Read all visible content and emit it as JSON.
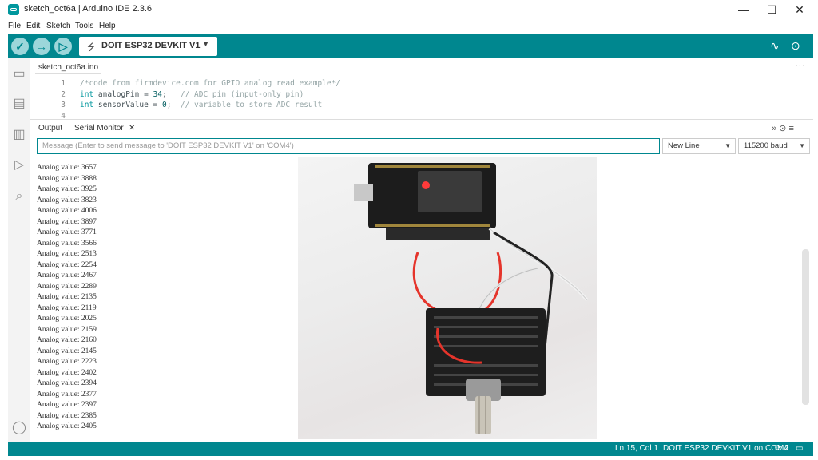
{
  "window": {
    "title": "sketch_oct6a | Arduino IDE 2.3.6",
    "minimize": "—",
    "maximize": "☐",
    "close": "✕"
  },
  "menu": [
    "File",
    "Edit",
    "Sketch",
    "Tools",
    "Help"
  ],
  "toolbar": {
    "verify_icon": "✓",
    "upload_icon": "→",
    "debug_icon": "▷",
    "board": "DOIT ESP32 DEVKIT V1",
    "board_caret": "▼",
    "plotter_icon": "∿",
    "monitor_icon": "⊙"
  },
  "sidebar_icons": [
    "folder-icon",
    "board-icon",
    "library-icon",
    "debug-icon",
    "search-icon",
    "account-icon"
  ],
  "editor": {
    "tab": "sketch_oct6a.ino",
    "more": "···",
    "lines": [
      {
        "num": "1",
        "parts": [
          {
            "t": "/*code from firmdevice.com for GPIO analog read example*/",
            "c": "cm"
          }
        ]
      },
      {
        "num": "2",
        "parts": [
          {
            "t": "int",
            "c": "kw"
          },
          {
            "t": " analogPin = ",
            "c": "tx"
          },
          {
            "t": "34",
            "c": "num"
          },
          {
            "t": ";   ",
            "c": "tx"
          },
          {
            "t": "// ADC pin (input-only pin)",
            "c": "cm"
          }
        ]
      },
      {
        "num": "3",
        "parts": [
          {
            "t": "int",
            "c": "kw"
          },
          {
            "t": " sensorValue = ",
            "c": "tx"
          },
          {
            "t": "0",
            "c": "num"
          },
          {
            "t": ";  ",
            "c": "tx"
          },
          {
            "t": "// variable to store ADC result",
            "c": "cm"
          }
        ]
      },
      {
        "num": "4",
        "parts": []
      }
    ]
  },
  "panel": {
    "tab_output": "Output",
    "tab_serial": "Serial Monitor",
    "tab_close": "✕",
    "right_icons": "»  ⊙  ≡",
    "message_placeholder": "Message (Enter to send message to 'DOIT ESP32 DEVKIT V1' on 'COM4')",
    "line_ending": "New Line",
    "baud": "115200 baud",
    "caret": "▼"
  },
  "serial_lines": [
    "Analog value: 3657",
    "Analog value: 3888",
    "Analog value: 3925",
    "Analog value: 3823",
    "Analog value: 4006",
    "Analog value: 3897",
    "Analog value: 3771",
    "Analog value: 3566",
    "Analog value: 2513",
    "Analog value: 2254",
    "Analog value: 2467",
    "Analog value: 2289",
    "Analog value: 2135",
    "Analog value: 2119",
    "Analog value: 2025",
    "Analog value: 2159",
    "Analog value: 2160",
    "Analog value: 2145",
    "Analog value: 2223",
    "Analog value: 2402",
    "Analog value: 2394",
    "Analog value: 2377",
    "Analog value: 2397",
    "Analog value: 2385",
    "Analog value: 2405"
  ],
  "status": {
    "position": "Ln 15, Col 1",
    "board_port": "DOIT ESP32 DEVKIT V1 on COM4",
    "notifications": "2",
    "notif_icon": "⟳",
    "layout_icon": "▭"
  }
}
